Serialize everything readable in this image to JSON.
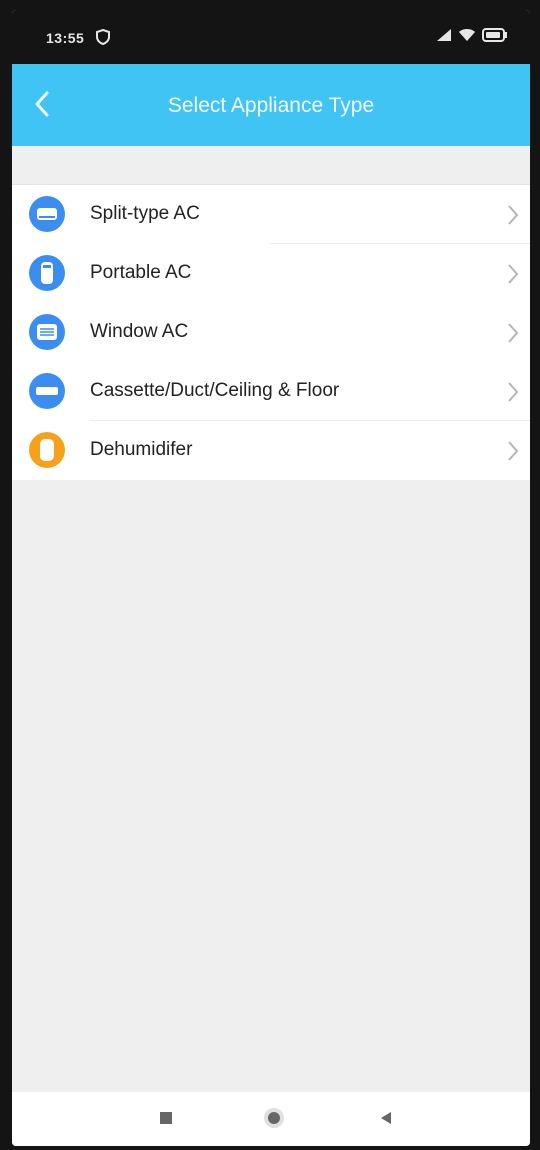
{
  "status_bar": {
    "time": "13:55",
    "icons": [
      "shield-icon",
      "signal-icon",
      "wifi-icon",
      "battery-icon"
    ]
  },
  "app_bar": {
    "title": "Select Appliance Type",
    "back_icon": "chevron-left-icon",
    "color": "#40c4f3"
  },
  "appliances": [
    {
      "label": "Split-type AC",
      "icon": "split-ac-icon",
      "color": "#3b8ef0"
    },
    {
      "label": "Portable AC",
      "icon": "portable-ac-icon",
      "color": "#3b8ef0"
    },
    {
      "label": "Window AC",
      "icon": "window-ac-icon",
      "color": "#3b8ef0"
    },
    {
      "label": "Cassette/Duct/Ceiling & Floor",
      "icon": "cassette-ac-icon",
      "color": "#3b8ef0"
    },
    {
      "label": "Dehumidifer",
      "icon": "dehumidifier-icon",
      "color": "#f5a21a"
    }
  ],
  "nav_bar": {
    "buttons": [
      "recents-square-icon",
      "home-circle-icon",
      "back-triangle-icon"
    ]
  }
}
